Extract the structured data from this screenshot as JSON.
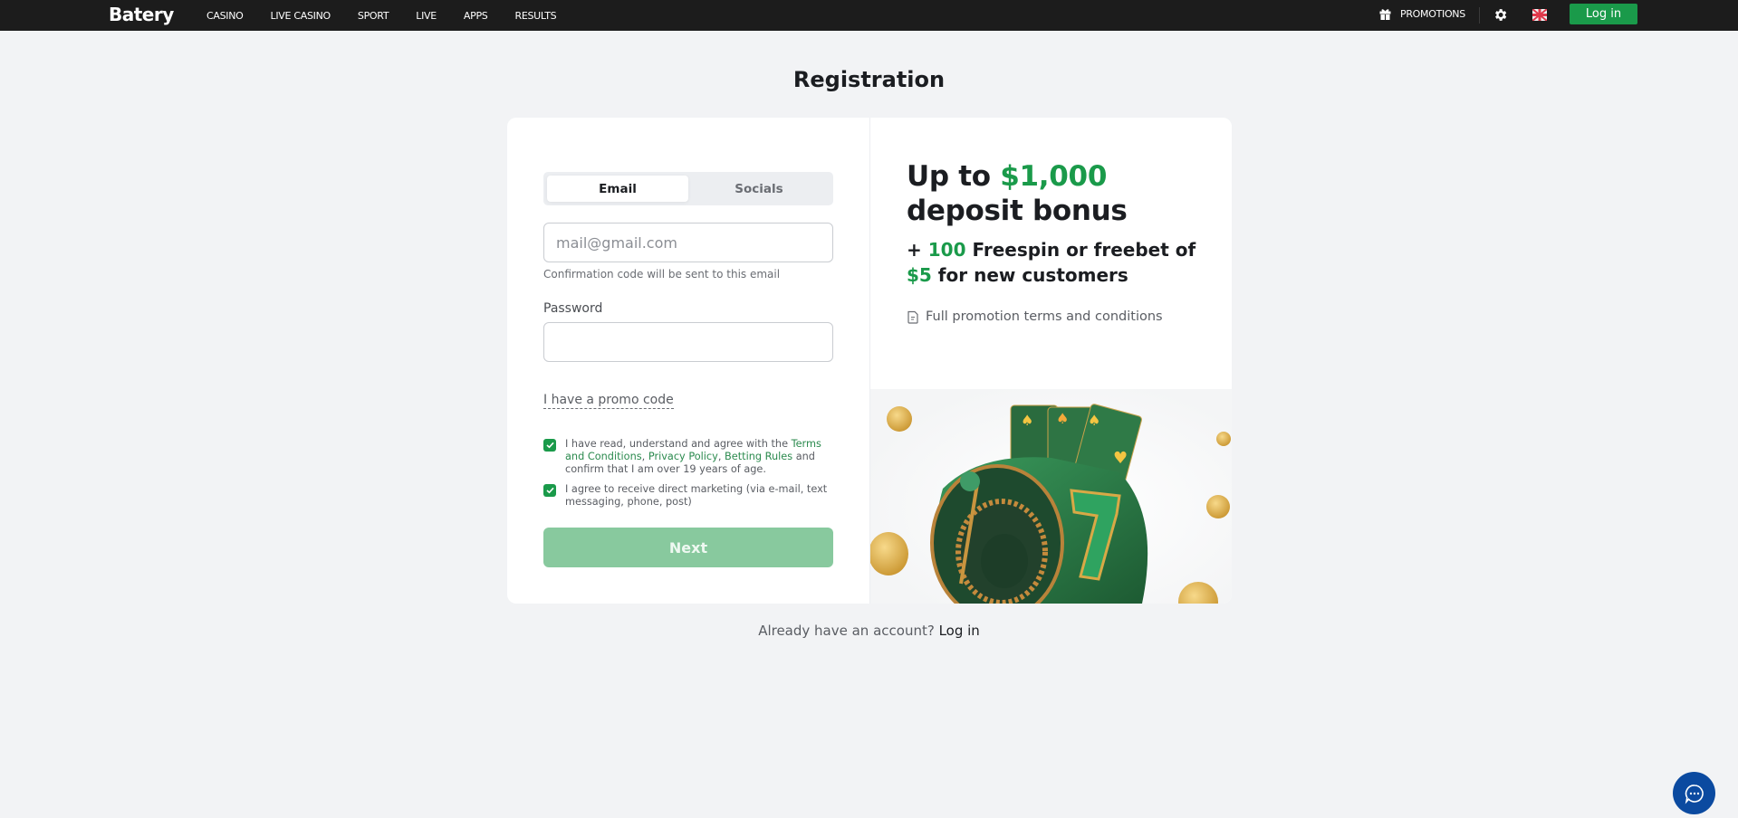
{
  "header": {
    "logo": "Batery",
    "nav": [
      "CASINO",
      "LIVE CASINO",
      "SPORT",
      "LIVE",
      "APPS",
      "RESULTS"
    ],
    "promotions_label": "PROMOTIONS",
    "login_label": "Log in",
    "icons": {
      "promotions": "gift-icon",
      "settings": "gear-icon",
      "language": "uk-flag-icon"
    }
  },
  "page": {
    "title": "Registration"
  },
  "form": {
    "tabs": [
      {
        "label": "Email",
        "active": true
      },
      {
        "label": "Socials",
        "active": false
      }
    ],
    "email": {
      "placeholder": "mail@gmail.com",
      "value": ""
    },
    "email_hint": "Confirmation code will be sent to this email",
    "password": {
      "label": "Password",
      "value": ""
    },
    "promo_link": "I have a promo code",
    "consents": [
      {
        "checked": true,
        "text_before": "I have read, understand and agree with the ",
        "link1": "Terms and Conditions",
        "sep1": ", ",
        "link2": "Privacy Policy",
        "sep2": ", ",
        "link3": "Betting Rules",
        "text_after": " and confirm that I am over 19 years of age."
      },
      {
        "checked": true,
        "text": "I agree to receive direct marketing (via e-mail, text messaging, phone, post)"
      }
    ],
    "next_label": "Next"
  },
  "promo_panel": {
    "title_prefix": "Up to ",
    "title_amount": "$1,000",
    "title_suffix": " deposit bonus",
    "sub_prefix": "+ ",
    "sub_count": "100",
    "sub_mid": " Freespin or freebet of ",
    "sub_amount": "$5",
    "sub_suffix": " for new customers",
    "terms_link": "Full promotion terms and conditions",
    "image_alt": "slot-machine-roulette-illustration"
  },
  "footer": {
    "already_text": "Already have an account? ",
    "login_link": "Log in"
  },
  "colors": {
    "brand_green": "#1a9a4a",
    "next_disabled": "#88c99e",
    "topbar": "#1c1c1c",
    "chat": "#0b4aa0",
    "page_bg": "#f2f3f5"
  },
  "chat": {
    "icon": "chat-bubble-icon"
  }
}
